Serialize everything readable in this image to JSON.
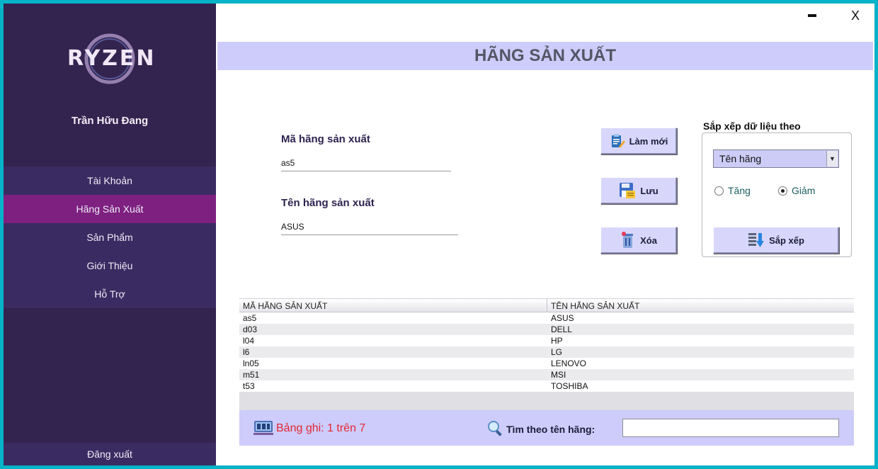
{
  "app": {
    "logo_text": "RYZEN",
    "user_name": "Trần Hữu Đang"
  },
  "window_controls": {
    "minimize": "-",
    "close": "X"
  },
  "sidebar": {
    "items": [
      {
        "label": "Tài Khoản",
        "active": false
      },
      {
        "label": "Hãng Sản Xuất",
        "active": true
      },
      {
        "label": "Sản Phẩm",
        "active": false
      },
      {
        "label": "Giới Thiệu",
        "active": false
      },
      {
        "label": "Hỗ Trợ",
        "active": false
      }
    ],
    "logout_label": "Đăng xuất"
  },
  "header": {
    "title": "HÃNG SẢN XUẤT"
  },
  "form": {
    "code_label": "Mã hãng sản xuất",
    "code_value": "as5",
    "name_label": "Tên hãng sản xuất",
    "name_value": "ASUS"
  },
  "actions": {
    "refresh_label": "Làm mới",
    "save_label": "Lưu",
    "delete_label": "Xóa"
  },
  "sort": {
    "title": "Sắp xếp dữ liệu theo",
    "selected_field": "Tên hãng",
    "asc_label": "Tăng",
    "desc_label": "Giảm",
    "selected_order": "desc",
    "button_label": "Sắp xếp"
  },
  "table": {
    "headers": [
      "MÃ HÃNG SẢN XUẤT",
      "TÊN HÃNG SẢN XUẤT"
    ],
    "rows": [
      [
        "as5",
        "ASUS"
      ],
      [
        "d03",
        "DELL"
      ],
      [
        "l04",
        "HP"
      ],
      [
        "l6",
        "LG"
      ],
      [
        "ln05",
        "LENOVO"
      ],
      [
        "m51",
        "MSI"
      ],
      [
        "t53",
        "TOSHIBA"
      ]
    ]
  },
  "footer": {
    "record_text": "Bảng ghi: 1 trên 7",
    "search_label": "Tìm theo tên hãng:",
    "search_value": ""
  },
  "colors": {
    "sidebar_bg": "#33234f",
    "active_item": "#7d2080",
    "header_band": "#cdccfa",
    "record_text": "#e52636",
    "window_border": "#06b3c8"
  }
}
